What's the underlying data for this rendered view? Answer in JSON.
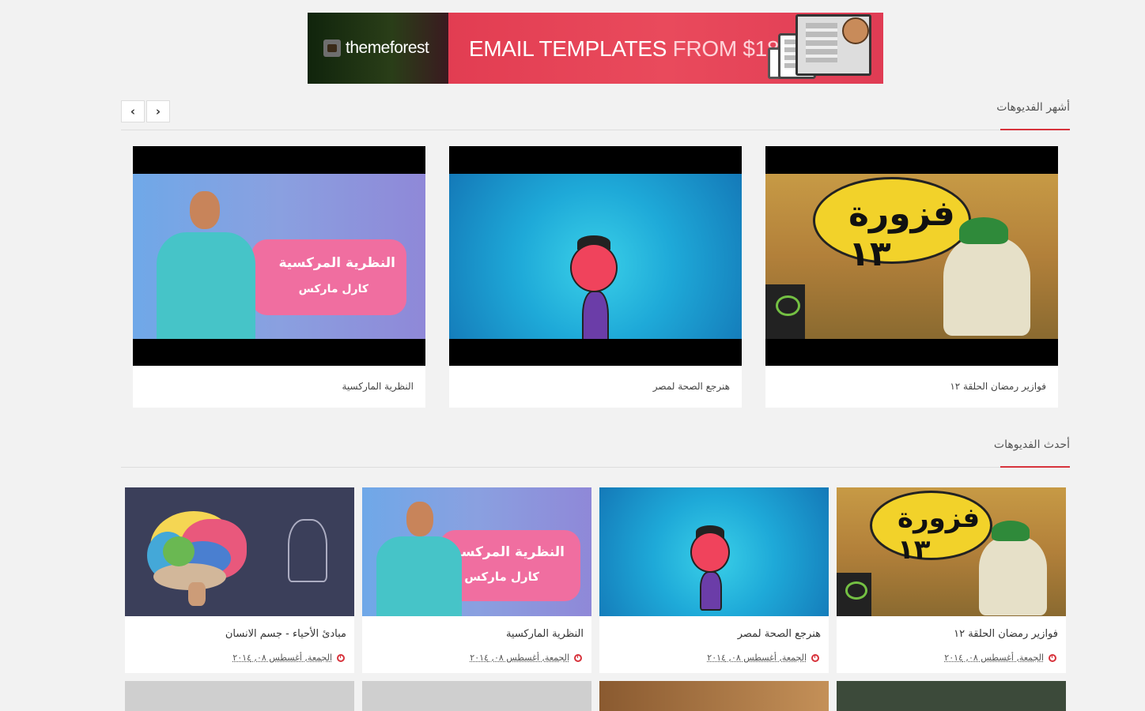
{
  "banner": {
    "brand": "themeforest",
    "headline_main": "EMAIL TEMPLATES",
    "headline_accent": "FROM $18"
  },
  "popular": {
    "title": "أشهر الفديوهات",
    "prev_label": "‹",
    "next_label": "›",
    "items": [
      {
        "title": "فوازير رمضان الحلقة ١٢",
        "thumb_text": "فزورة ١٣"
      },
      {
        "title": "هنرجع الصحة لمصر"
      },
      {
        "title": "النظرية الماركسية",
        "thumb_text_1": "النظرية المركسية",
        "thumb_text_2": "كارل ماركس"
      }
    ]
  },
  "latest": {
    "title": "أحدث الفديوهات",
    "items": [
      {
        "title": "فوازير رمضان الحلقة ١٢",
        "date": "الجمعة, أغسطس ٠٨, ٢٠١٤",
        "thumb_text": "فزورة ١٣",
        "logo_text": "اتصالات etisalat"
      },
      {
        "title": "هنرجع الصحة لمصر",
        "date": "الجمعة, أغسطس ٠٨, ٢٠١٤"
      },
      {
        "title": "النظرية الماركسية",
        "date": "الجمعة, أغسطس ٠٨, ٢٠١٤",
        "thumb_text_1": "النظرية المركسية",
        "thumb_text_2": "كارل ماركس"
      },
      {
        "title": "مبادئ الأحياء - جسم الانسان",
        "date": "الجمعة, أغسطس ٠٨, ٢٠١٤"
      }
    ]
  },
  "colors": {
    "accent": "#d7333c",
    "page_bg": "#f2f2f2"
  }
}
